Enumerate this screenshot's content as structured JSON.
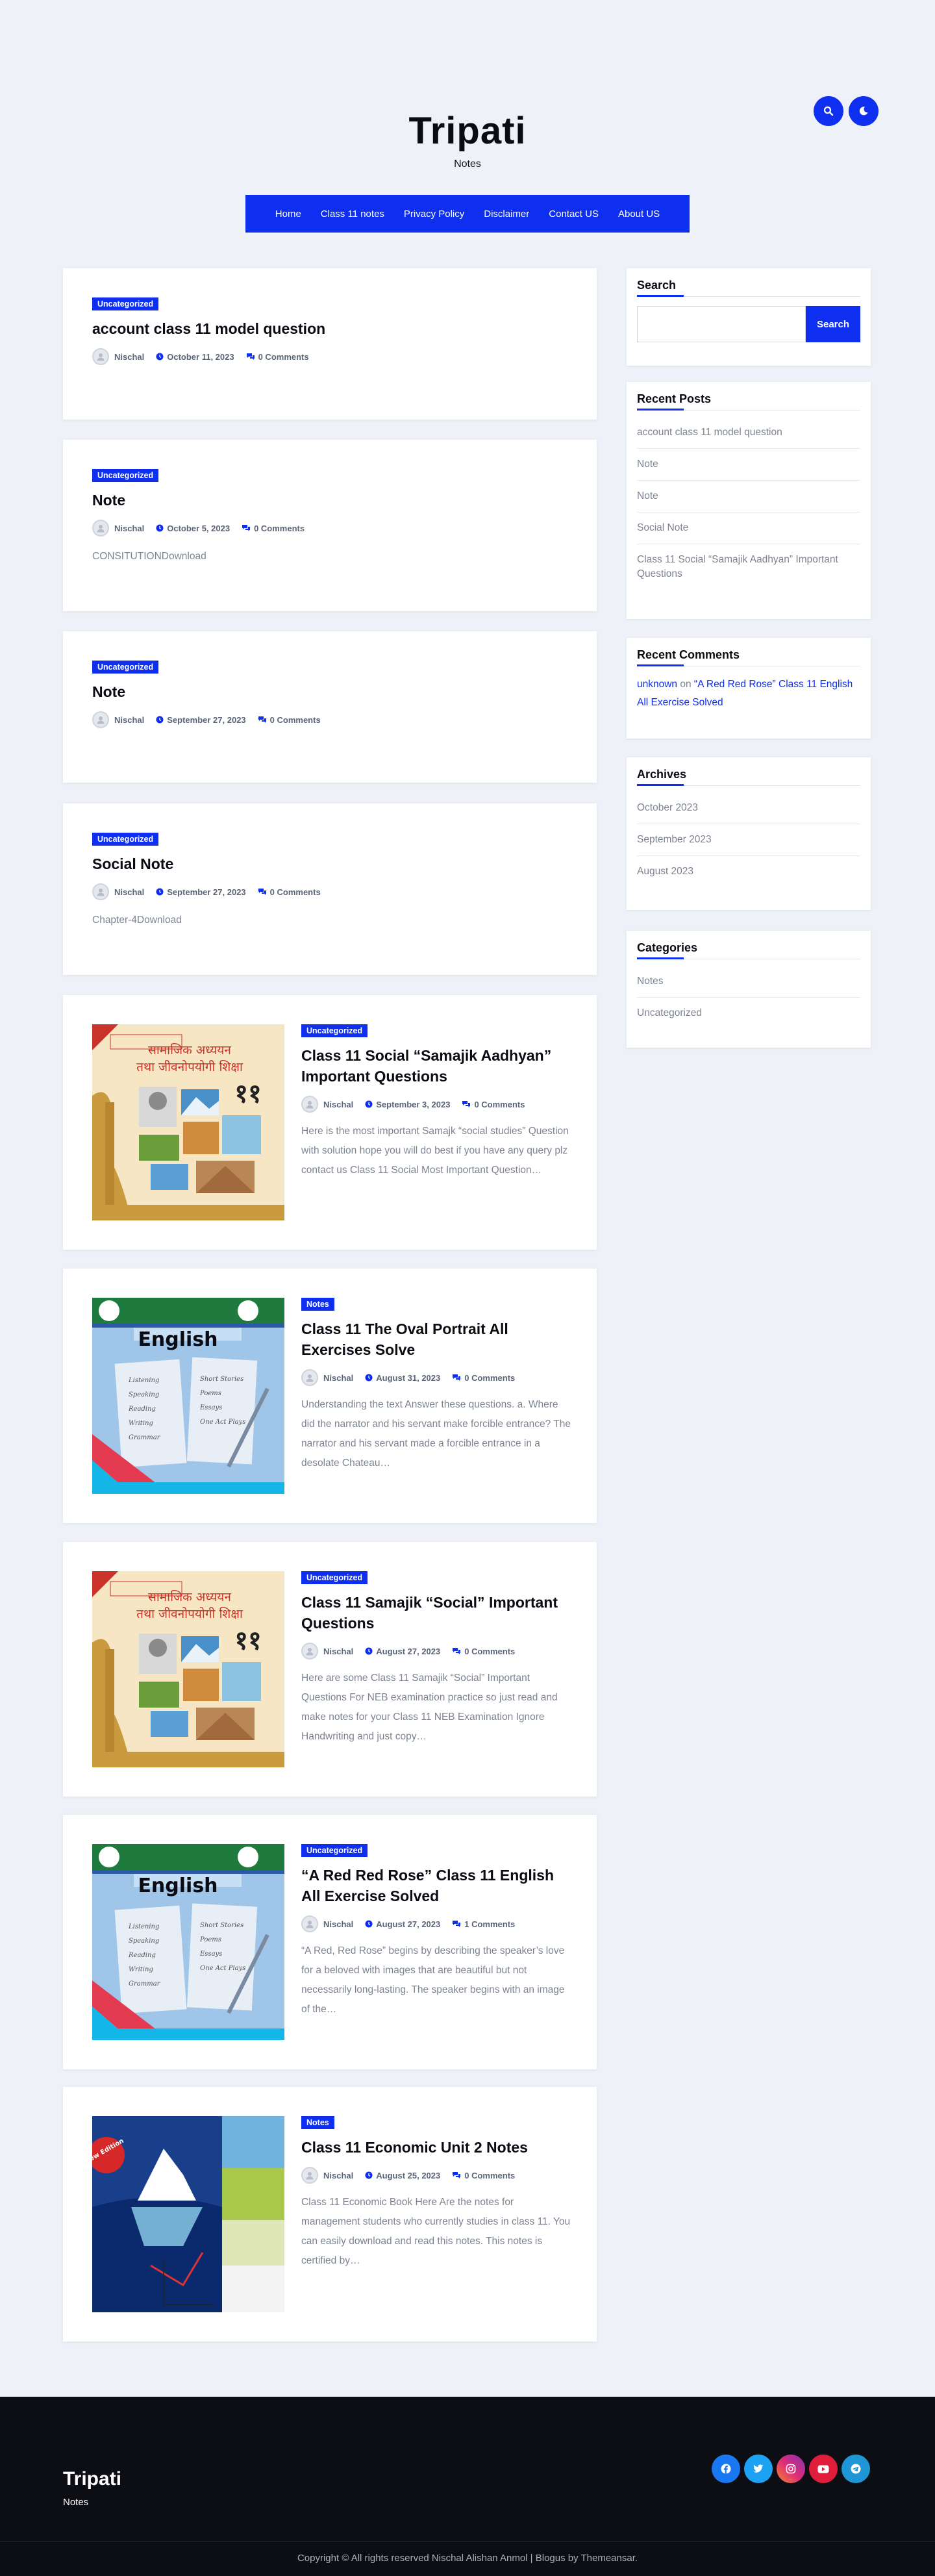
{
  "site": {
    "title": "Tripati",
    "tagline": "Notes"
  },
  "nav": [
    "Home",
    "Class 11 notes",
    "Privacy Policy",
    "Disclaimer",
    "Contact US",
    "About US"
  ],
  "posts": [
    {
      "category": "Uncategorized",
      "title": "account class 11 model question",
      "author": "Nischal",
      "date": "October 11, 2023",
      "comments": "0 Comments",
      "excerpt": ""
    },
    {
      "category": "Uncategorized",
      "title": "Note",
      "author": "Nischal",
      "date": "October 5, 2023",
      "comments": "0 Comments",
      "excerpt": "CONSITUTIONDownload"
    },
    {
      "category": "Uncategorized",
      "title": "Note",
      "author": "Nischal",
      "date": "September 27, 2023",
      "comments": "0 Comments",
      "excerpt": ""
    },
    {
      "category": "Uncategorized",
      "title": "Social Note",
      "author": "Nischal",
      "date": "September 27, 2023",
      "comments": "0 Comments",
      "excerpt": "Chapter-4Download"
    },
    {
      "category": "Uncategorized",
      "title": "Class 11 Social “Samajik Aadhyan” Important Questions",
      "author": "Nischal",
      "date": "September 3, 2023",
      "comments": "0 Comments",
      "excerpt": "Here is the most important Samajk “social studies” Question with solution hope you will do best if you have any query plz contact us Class 11 Social Most Important Question…",
      "thumb": "social"
    },
    {
      "category": "Notes",
      "title": "Class 11 The Oval Portrait All Exercises Solve",
      "author": "Nischal",
      "date": "August 31, 2023",
      "comments": "0 Comments",
      "excerpt": "Understanding the text Answer these questions. a. Where did the narrator and his servant make forcible entrance? The narrator and his servant made a forcible entrance in a desolate Chateau…",
      "thumb": "english"
    },
    {
      "category": "Uncategorized",
      "title": "Class 11 Samajik “Social” Important Questions",
      "author": "Nischal",
      "date": "August 27, 2023",
      "comments": "0 Comments",
      "excerpt": "Here are some Class 11 Samajik “Social” Important Questions For NEB examination practice so just read and make notes for your Class 11 NEB Examination Ignore Handwriting and just copy…",
      "thumb": "social"
    },
    {
      "category": "Uncategorized",
      "title": "“A Red Red Rose” Class 11 English All Exercise Solved",
      "author": "Nischal",
      "date": "August 27, 2023",
      "comments": "1 Comments",
      "excerpt": "“A Red, Red Rose” begins by describing the speaker’s love for a beloved with images that are beautiful but not necessarily long-lasting. The speaker begins with an image of the…",
      "thumb": "english"
    },
    {
      "category": "Notes",
      "title": "Class 11 Economic Unit 2 Notes",
      "author": "Nischal",
      "date": "August 25, 2023",
      "comments": "0 Comments",
      "excerpt": "Class 11 Economic Book Here Are the notes for management students who currently studies in class 11. You can easily download and read this notes. This notes is certified by…",
      "thumb": "economics"
    }
  ],
  "thumbs": {
    "social_text_line1": "सामाजिक अध्ययन",
    "social_text_line2": "तथा जीवनोपयोगी शिक्षा",
    "social_number": "११",
    "english_title": "English",
    "english_left": [
      "Listening",
      "Speaking",
      "Reading",
      "Writing",
      "Grammar"
    ],
    "english_right": [
      "Short Stories",
      "Poems",
      "Essays",
      "One Act Plays"
    ],
    "economics_ribbon": "New Edition"
  },
  "sidebar": {
    "search": {
      "title": "Search",
      "button": "Search",
      "placeholder": ""
    },
    "recent_posts": {
      "title": "Recent Posts",
      "items": [
        "account class 11 model question",
        "Note",
        "Note",
        "Social Note",
        "Class 11 Social “Samajik Aadhyan” Important Questions"
      ]
    },
    "recent_comments": {
      "title": "Recent Comments",
      "author": "unknown",
      "on": "on",
      "post": "“A Red Red Rose” Class 11 English All Exercise Solved"
    },
    "archives": {
      "title": "Archives",
      "items": [
        "October 2023",
        "September 2023",
        "August 2023"
      ]
    },
    "categories": {
      "title": "Categories",
      "items": [
        "Notes",
        "Uncategorized"
      ]
    }
  },
  "footer": {
    "title": "Tripati",
    "tagline": "Notes",
    "copyright": "Copyright © All rights reserved Nischal Alishan Anmol | Blogus by Themeansar."
  },
  "colors": {
    "accent": "#0e2ef0",
    "footer_bg": "#0d0e13",
    "page_bg": "#eef1f7"
  },
  "icons": {
    "header": [
      "search-icon",
      "moon-icon"
    ],
    "social": [
      "facebook-icon",
      "twitter-icon",
      "instagram-icon",
      "youtube-icon",
      "telegram-icon"
    ]
  }
}
